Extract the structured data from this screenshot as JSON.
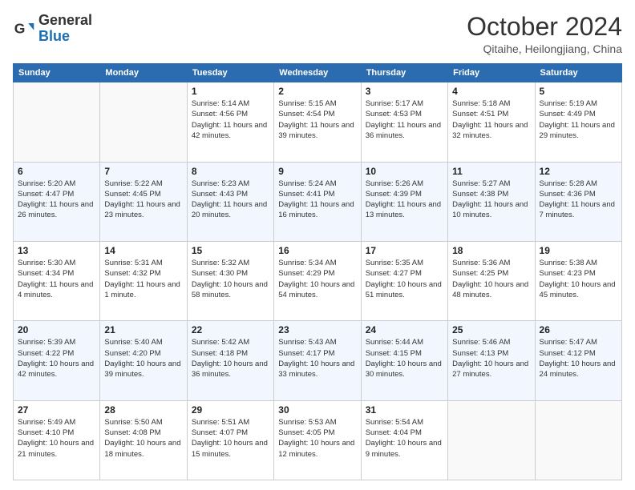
{
  "header": {
    "logo_general": "General",
    "logo_blue": "Blue",
    "month_title": "October 2024",
    "subtitle": "Qitaihe, Heilongjiang, China"
  },
  "days_of_week": [
    "Sunday",
    "Monday",
    "Tuesday",
    "Wednesday",
    "Thursday",
    "Friday",
    "Saturday"
  ],
  "weeks": [
    [
      {
        "day": "",
        "info": ""
      },
      {
        "day": "",
        "info": ""
      },
      {
        "day": "1",
        "info": "Sunrise: 5:14 AM\nSunset: 4:56 PM\nDaylight: 11 hours and 42 minutes."
      },
      {
        "day": "2",
        "info": "Sunrise: 5:15 AM\nSunset: 4:54 PM\nDaylight: 11 hours and 39 minutes."
      },
      {
        "day": "3",
        "info": "Sunrise: 5:17 AM\nSunset: 4:53 PM\nDaylight: 11 hours and 36 minutes."
      },
      {
        "day": "4",
        "info": "Sunrise: 5:18 AM\nSunset: 4:51 PM\nDaylight: 11 hours and 32 minutes."
      },
      {
        "day": "5",
        "info": "Sunrise: 5:19 AM\nSunset: 4:49 PM\nDaylight: 11 hours and 29 minutes."
      }
    ],
    [
      {
        "day": "6",
        "info": "Sunrise: 5:20 AM\nSunset: 4:47 PM\nDaylight: 11 hours and 26 minutes."
      },
      {
        "day": "7",
        "info": "Sunrise: 5:22 AM\nSunset: 4:45 PM\nDaylight: 11 hours and 23 minutes."
      },
      {
        "day": "8",
        "info": "Sunrise: 5:23 AM\nSunset: 4:43 PM\nDaylight: 11 hours and 20 minutes."
      },
      {
        "day": "9",
        "info": "Sunrise: 5:24 AM\nSunset: 4:41 PM\nDaylight: 11 hours and 16 minutes."
      },
      {
        "day": "10",
        "info": "Sunrise: 5:26 AM\nSunset: 4:39 PM\nDaylight: 11 hours and 13 minutes."
      },
      {
        "day": "11",
        "info": "Sunrise: 5:27 AM\nSunset: 4:38 PM\nDaylight: 11 hours and 10 minutes."
      },
      {
        "day": "12",
        "info": "Sunrise: 5:28 AM\nSunset: 4:36 PM\nDaylight: 11 hours and 7 minutes."
      }
    ],
    [
      {
        "day": "13",
        "info": "Sunrise: 5:30 AM\nSunset: 4:34 PM\nDaylight: 11 hours and 4 minutes."
      },
      {
        "day": "14",
        "info": "Sunrise: 5:31 AM\nSunset: 4:32 PM\nDaylight: 11 hours and 1 minute."
      },
      {
        "day": "15",
        "info": "Sunrise: 5:32 AM\nSunset: 4:30 PM\nDaylight: 10 hours and 58 minutes."
      },
      {
        "day": "16",
        "info": "Sunrise: 5:34 AM\nSunset: 4:29 PM\nDaylight: 10 hours and 54 minutes."
      },
      {
        "day": "17",
        "info": "Sunrise: 5:35 AM\nSunset: 4:27 PM\nDaylight: 10 hours and 51 minutes."
      },
      {
        "day": "18",
        "info": "Sunrise: 5:36 AM\nSunset: 4:25 PM\nDaylight: 10 hours and 48 minutes."
      },
      {
        "day": "19",
        "info": "Sunrise: 5:38 AM\nSunset: 4:23 PM\nDaylight: 10 hours and 45 minutes."
      }
    ],
    [
      {
        "day": "20",
        "info": "Sunrise: 5:39 AM\nSunset: 4:22 PM\nDaylight: 10 hours and 42 minutes."
      },
      {
        "day": "21",
        "info": "Sunrise: 5:40 AM\nSunset: 4:20 PM\nDaylight: 10 hours and 39 minutes."
      },
      {
        "day": "22",
        "info": "Sunrise: 5:42 AM\nSunset: 4:18 PM\nDaylight: 10 hours and 36 minutes."
      },
      {
        "day": "23",
        "info": "Sunrise: 5:43 AM\nSunset: 4:17 PM\nDaylight: 10 hours and 33 minutes."
      },
      {
        "day": "24",
        "info": "Sunrise: 5:44 AM\nSunset: 4:15 PM\nDaylight: 10 hours and 30 minutes."
      },
      {
        "day": "25",
        "info": "Sunrise: 5:46 AM\nSunset: 4:13 PM\nDaylight: 10 hours and 27 minutes."
      },
      {
        "day": "26",
        "info": "Sunrise: 5:47 AM\nSunset: 4:12 PM\nDaylight: 10 hours and 24 minutes."
      }
    ],
    [
      {
        "day": "27",
        "info": "Sunrise: 5:49 AM\nSunset: 4:10 PM\nDaylight: 10 hours and 21 minutes."
      },
      {
        "day": "28",
        "info": "Sunrise: 5:50 AM\nSunset: 4:08 PM\nDaylight: 10 hours and 18 minutes."
      },
      {
        "day": "29",
        "info": "Sunrise: 5:51 AM\nSunset: 4:07 PM\nDaylight: 10 hours and 15 minutes."
      },
      {
        "day": "30",
        "info": "Sunrise: 5:53 AM\nSunset: 4:05 PM\nDaylight: 10 hours and 12 minutes."
      },
      {
        "day": "31",
        "info": "Sunrise: 5:54 AM\nSunset: 4:04 PM\nDaylight: 10 hours and 9 minutes."
      },
      {
        "day": "",
        "info": ""
      },
      {
        "day": "",
        "info": ""
      }
    ]
  ]
}
